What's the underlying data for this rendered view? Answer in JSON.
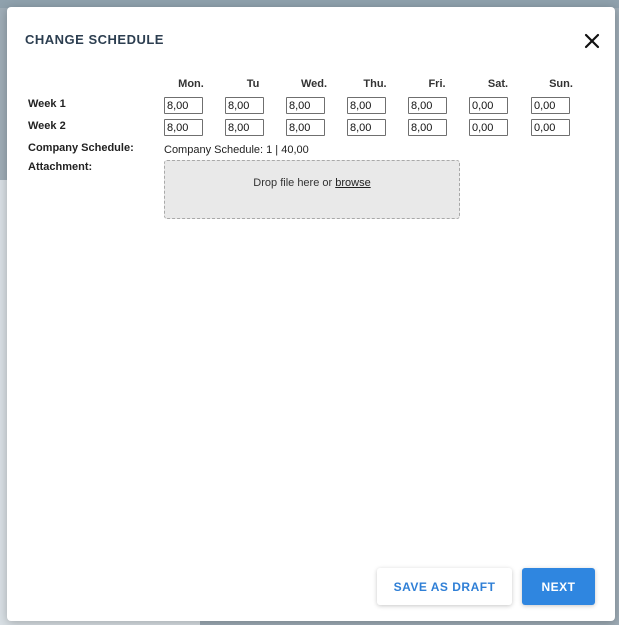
{
  "modal": {
    "title": "CHANGE SCHEDULE",
    "close_icon": "close-icon"
  },
  "schedule": {
    "days": [
      "Mon.",
      "Tu",
      "Wed.",
      "Thu.",
      "Fri.",
      "Sat.",
      "Sun."
    ],
    "weeks": [
      {
        "label": "Week 1",
        "values": [
          "8,00",
          "8,00",
          "8,00",
          "8,00",
          "8,00",
          "0,00",
          "0,00"
        ]
      },
      {
        "label": "Week 2",
        "values": [
          "8,00",
          "8,00",
          "8,00",
          "8,00",
          "8,00",
          "0,00",
          "0,00"
        ]
      }
    ]
  },
  "company_schedule": {
    "label": "Company Schedule:",
    "value": "Company Schedule: 1 | 40,00"
  },
  "attachment": {
    "label": "Attachment:",
    "drop_text": "Drop file here or",
    "browse_label": "browse"
  },
  "footer": {
    "draft_label": "SAVE AS DRAFT",
    "next_label": "NEXT"
  },
  "colors": {
    "accent": "#2f86e0",
    "title": "#2c3e50"
  }
}
